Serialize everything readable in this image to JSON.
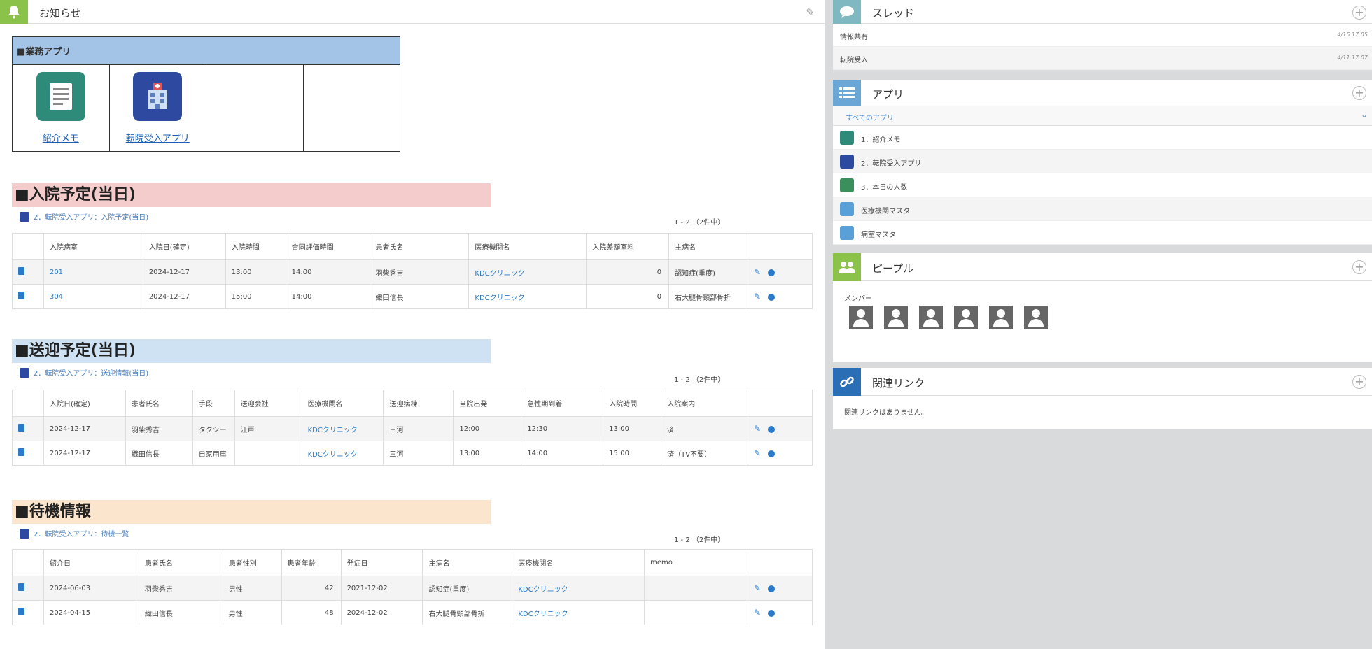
{
  "notice": {
    "title": "お知らせ"
  },
  "apps": {
    "header": "■業務アプリ",
    "items": [
      {
        "label": "紹介メモ"
      },
      {
        "label": "転院受入アプリ"
      }
    ]
  },
  "admission": {
    "heading": "■入院予定(当日)",
    "link": "2．転院受入アプリ：入院予定(当日)",
    "count": "1 - 2 （2件中）",
    "columns": [
      "入院病室",
      "入院日(確定)",
      "入院時間",
      "合同評価時間",
      "患者氏名",
      "医療機関名",
      "入院差額室料",
      "主病名"
    ],
    "rows": [
      [
        "201",
        "2024-12-17",
        "13:00",
        "14:00",
        "羽柴秀吉",
        "KDCクリニック",
        "0",
        "認知症(重度)"
      ],
      [
        "304",
        "2024-12-17",
        "15:00",
        "14:00",
        "織田信長",
        "KDCクリニック",
        "0",
        "右大腿骨頸部骨折"
      ]
    ]
  },
  "transport": {
    "heading": "■送迎予定(当日)",
    "link": "2．転院受入アプリ：送迎情報(当日)",
    "count": "1 - 2 （2件中）",
    "columns": [
      "入院日(確定)",
      "患者氏名",
      "手段",
      "送迎会社",
      "医療機関名",
      "送迎病棟",
      "当院出発",
      "急性期到着",
      "入院時間",
      "入院案内"
    ],
    "rows": [
      [
        "2024-12-17",
        "羽柴秀吉",
        "タクシー",
        "江戸",
        "KDCクリニック",
        "三河",
        "12:00",
        "12:30",
        "13:00",
        "済"
      ],
      [
        "2024-12-17",
        "織田信長",
        "自家用車",
        "",
        "KDCクリニック",
        "三河",
        "13:00",
        "14:00",
        "15:00",
        "済（TV不要）"
      ]
    ]
  },
  "waiting": {
    "heading": "■待機情報",
    "link": "2．転院受入アプリ：待機一覧",
    "count": "1 - 2 （2件中）",
    "columns": [
      "紹介日",
      "患者氏名",
      "患者性別",
      "患者年齢",
      "発症日",
      "主病名",
      "医療機関名",
      "memo"
    ],
    "rows": [
      [
        "2024-06-03",
        "羽柴秀吉",
        "男性",
        "42",
        "2021-12-02",
        "認知症(重度)",
        "KDCクリニック",
        ""
      ],
      [
        "2024-04-15",
        "織田信長",
        "男性",
        "48",
        "2024-12-02",
        "右大腿骨頸部骨折",
        "KDCクリニック",
        ""
      ]
    ]
  },
  "thread": {
    "title": "スレッド",
    "items": [
      {
        "label": "情報共有",
        "time": "4/15 17:05"
      },
      {
        "label": "転院受入",
        "time": "4/11 17:07"
      }
    ]
  },
  "appsPanel": {
    "title": "アプリ",
    "filter": "すべてのアプリ",
    "items": [
      {
        "label": "1．紹介メモ",
        "color": "#2e8b7a"
      },
      {
        "label": "2．転院受入アプリ",
        "color": "#2d4aa0"
      },
      {
        "label": "3．本日の人数",
        "color": "#3a8f5c"
      },
      {
        "label": "医療機関マスタ",
        "color": "#5aa0d8"
      },
      {
        "label": "病室マスタ",
        "color": "#5aa0d8"
      }
    ]
  },
  "people": {
    "title": "ピープル",
    "members_label": "メンバー",
    "member_count": 6
  },
  "links": {
    "title": "関連リンク",
    "empty": "関連リンクはありません。"
  },
  "colors": {
    "admission_bg": "#f4cccc",
    "transport_bg": "#cfe2f3",
    "waiting_bg": "#fce5cd"
  }
}
